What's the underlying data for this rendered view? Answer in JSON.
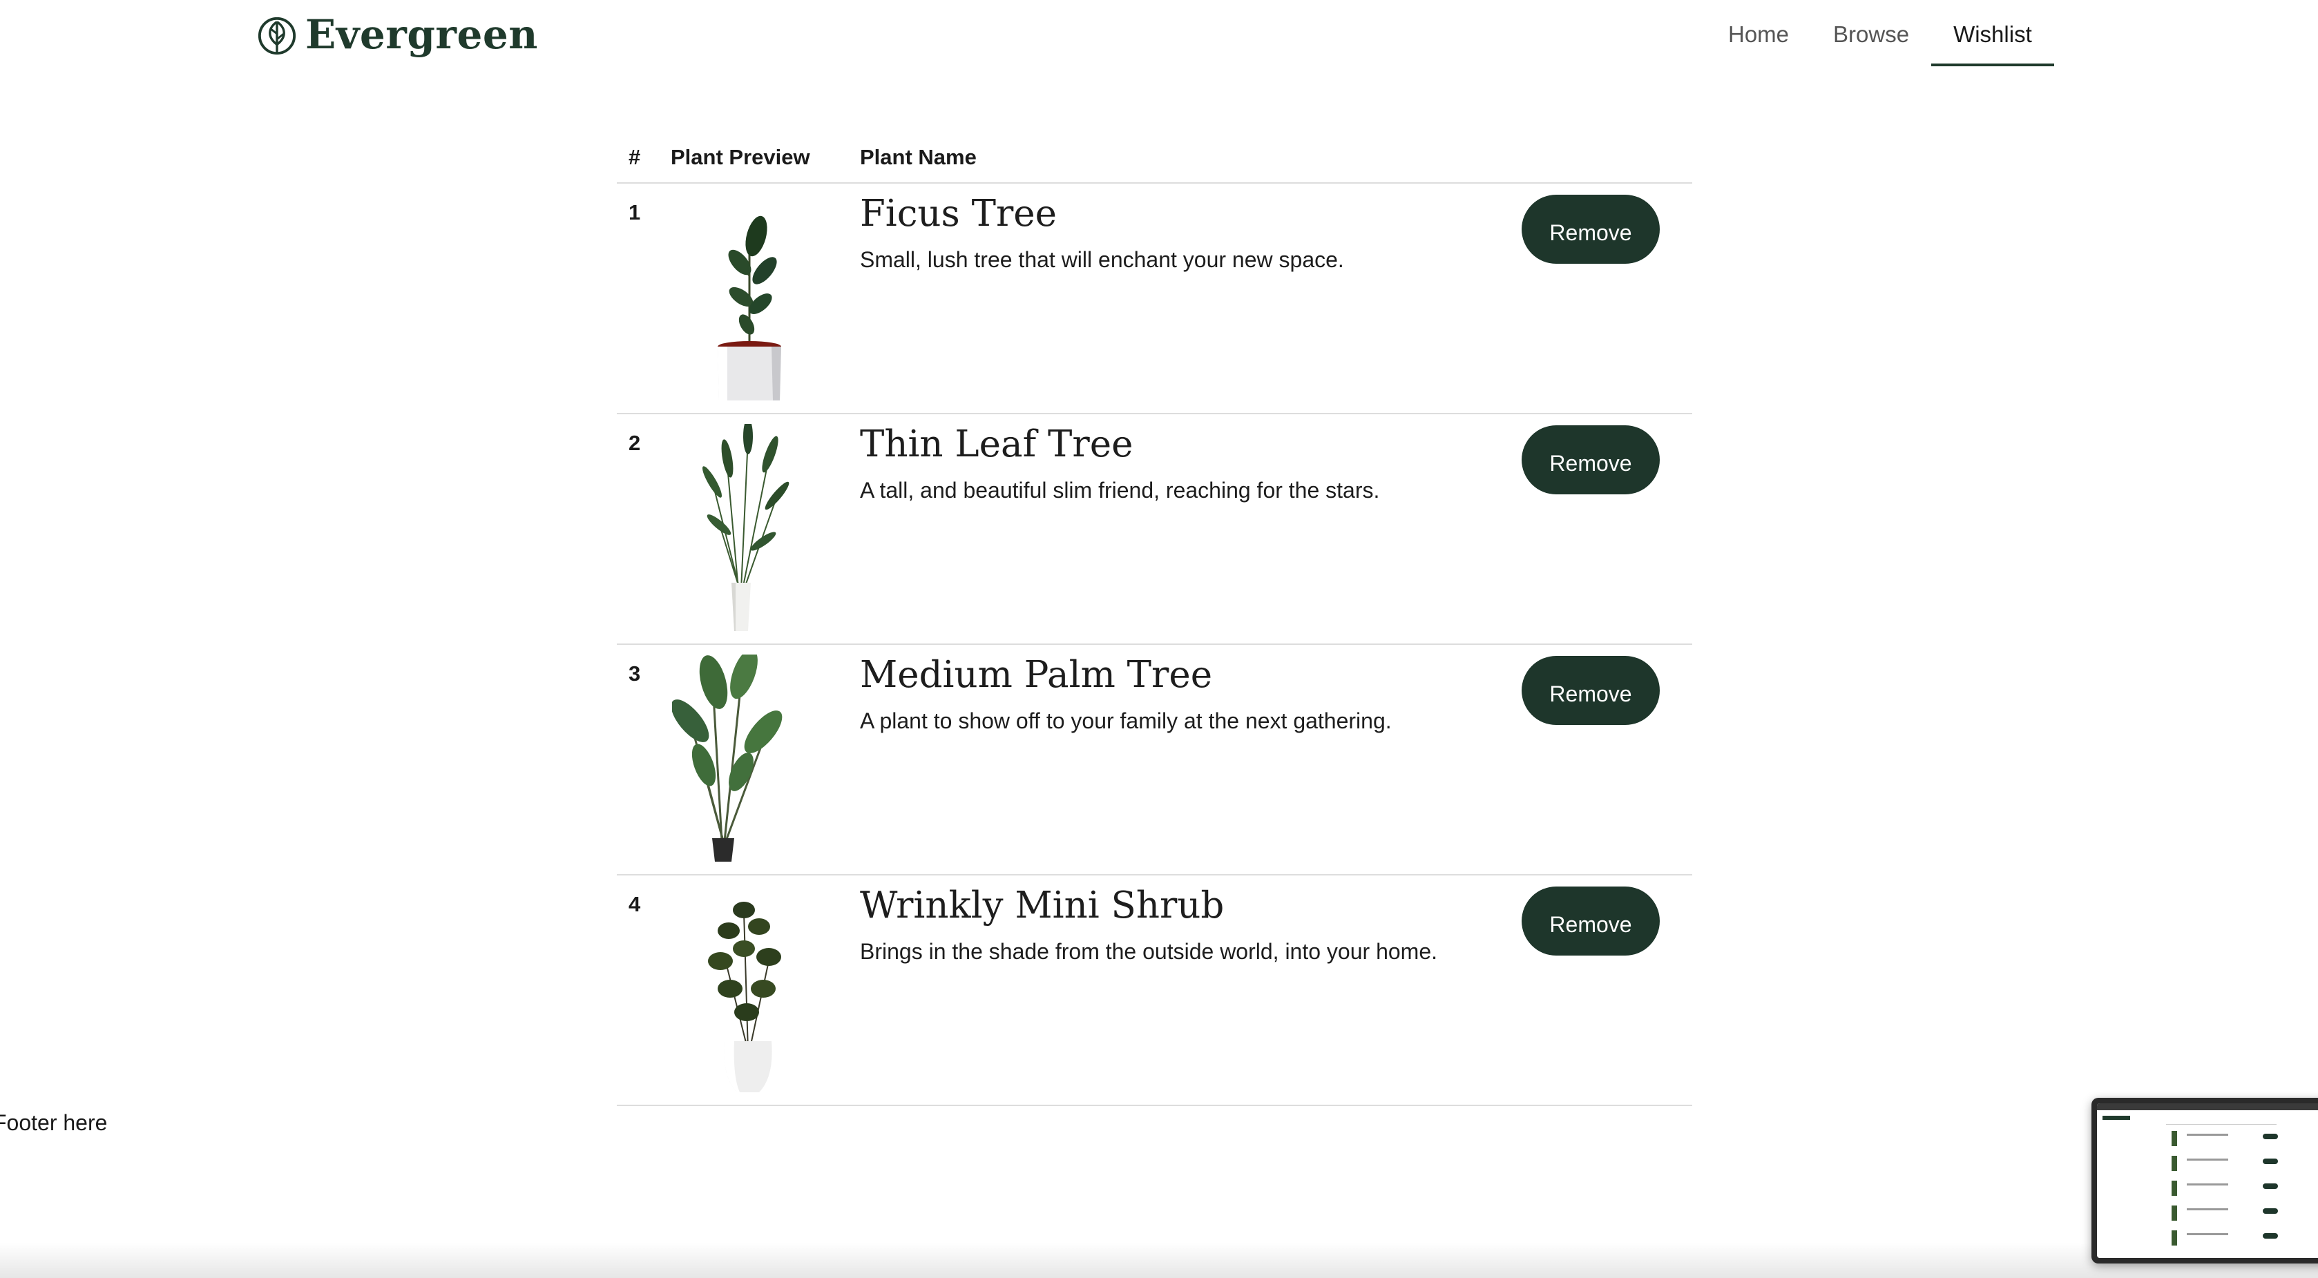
{
  "brand": {
    "name": "Evergreen",
    "accent": "#1f3a2c",
    "button_bg": "#1e362b"
  },
  "nav": {
    "items": [
      {
        "label": "Home",
        "active": false
      },
      {
        "label": "Browse",
        "active": false
      },
      {
        "label": "Wishlist",
        "active": true
      }
    ]
  },
  "table": {
    "headers": {
      "num": "#",
      "preview": "Plant Preview",
      "name": "Plant Name"
    },
    "rows": [
      {
        "num": "1",
        "title": "Ficus Tree",
        "desc": "Small, lush tree that will enchant your new space.",
        "button": "Remove",
        "image": "ficus-plant-icon"
      },
      {
        "num": "2",
        "title": "Thin Leaf Tree",
        "desc": "A tall, and beautiful slim friend, reaching for the stars.",
        "button": "Remove",
        "image": "thin-leaf-plant-icon"
      },
      {
        "num": "3",
        "title": "Medium Palm Tree",
        "desc": "A plant to show off to your family at the next gathering.",
        "button": "Remove",
        "image": "palm-plant-icon"
      },
      {
        "num": "4",
        "title": "Wrinkly Mini Shrub",
        "desc": "Brings in the shade from the outside world, into your home.",
        "button": "Remove",
        "image": "shrub-plant-icon"
      }
    ]
  },
  "footer": {
    "text": "Footer here"
  }
}
